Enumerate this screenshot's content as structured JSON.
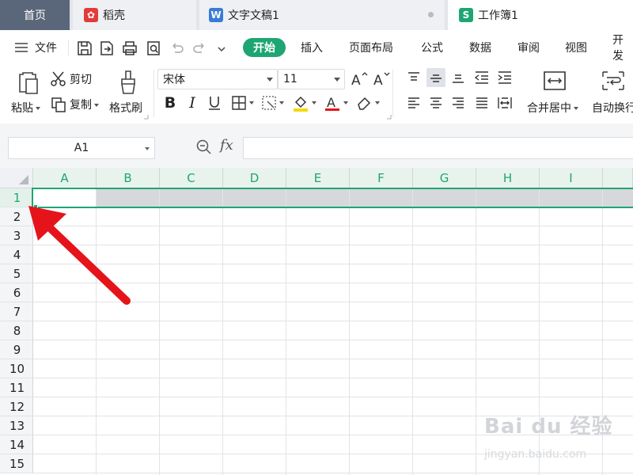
{
  "tabs": {
    "home": "首页",
    "daoke": "稻壳",
    "doc": "文字文稿1",
    "book": "工作簿1"
  },
  "menu": {
    "file": "文件",
    "start": "开始",
    "insert": "插入",
    "layout": "页面布局",
    "formula": "公式",
    "data": "数据",
    "review": "审阅",
    "view": "视图",
    "dev": "开发"
  },
  "ribbon": {
    "paste": "粘贴",
    "cut": "剪切",
    "copy": "复制",
    "format_painter": "格式刷",
    "font_name": "宋体",
    "font_size": "11",
    "merge_center": "合并居中",
    "wrap": "自动换行"
  },
  "formula_bar": {
    "cell_ref": "A1",
    "fx": "fx",
    "content": ""
  },
  "columns": [
    "A",
    "B",
    "C",
    "D",
    "E",
    "F",
    "G",
    "H",
    "I"
  ],
  "rows": [
    "1",
    "2",
    "3",
    "4",
    "5",
    "6",
    "7",
    "8",
    "9",
    "10",
    "11",
    "12",
    "13",
    "14",
    "15"
  ],
  "selected_row": "1",
  "watermark": {
    "brand": "Bai du 经验",
    "url": "jingyan.baidu.com"
  },
  "colors": {
    "accent": "#1ea672",
    "arrow": "#e5141b",
    "home_tab": "#5a6679"
  }
}
